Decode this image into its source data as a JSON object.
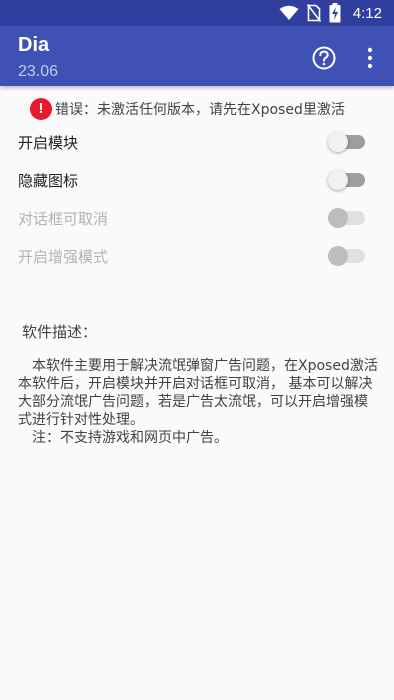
{
  "status_bar": {
    "time": "4:12",
    "icons": [
      "wifi-icon",
      "no-sim-icon",
      "battery-charging-icon"
    ]
  },
  "app_bar": {
    "title": "Dia",
    "subtitle": "23.06",
    "actions": [
      "help-icon",
      "more-vert-icon"
    ]
  },
  "error": {
    "icon": "error-icon",
    "icon_glyph": "!",
    "text": "错误：未激活任何版本，请先在Xposed里激活",
    "icon_color": "#e8192c"
  },
  "settings": [
    {
      "label": "开启模块",
      "enabled": true,
      "checked": false
    },
    {
      "label": "隐藏图标",
      "enabled": true,
      "checked": false
    },
    {
      "label": "对话框可取消",
      "enabled": false,
      "checked": false
    },
    {
      "label": "开启增强模式",
      "enabled": false,
      "checked": false
    }
  ],
  "description": {
    "title": "软件描述：",
    "body": "本软件主要用于解决流氓弹窗广告问题，在Xposed激活本软件后，开启模块并开启对话框可取消， 基本可以解决大部分流氓广告问题，若是广告太流氓，可以开启增强模式进行针对性处理。",
    "note": "注：不支持游戏和网页中广告。"
  },
  "colors": {
    "status_bar": "#303f9f",
    "app_bar": "#3f51b5",
    "background": "#fafafa"
  }
}
